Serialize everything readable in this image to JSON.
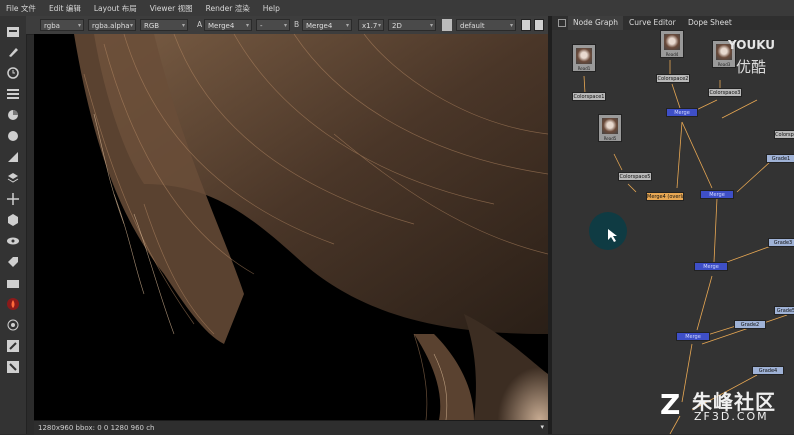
{
  "menu": [
    "File 文件",
    "Edit 编辑",
    "Layout 布局",
    "Viewer 视图",
    "Render 渲染",
    "Help"
  ],
  "viewer_toolbar": {
    "channels": "rgba",
    "channel_alpha": "rgba.alpha",
    "display": "RGB",
    "a_label": "A",
    "a_input": "Merge4",
    "dash": "-",
    "b_label": "B",
    "b_input": "Merge4",
    "zoom": "x1.7",
    "view_mode": "2D",
    "lut": "default"
  },
  "status": {
    "text": "1280x960 bbox: 0 0 1280 960 ch",
    "caret": "▾"
  },
  "node_graph": {
    "tabs": [
      "Node Graph",
      "Curve Editor",
      "Dope Sheet"
    ],
    "thumbs": [
      "Read1",
      "Read4",
      "Read3",
      "Read5"
    ],
    "nodes": [
      "Colorspace1",
      "Colorspace2",
      "Colorspace3",
      "Colorspace4",
      "Colorspace5",
      "Merge4 (overlay)",
      "Merge",
      "Merge",
      "Merge",
      "Merge",
      "Grade1",
      "Grade2",
      "Grade3",
      "Grade4",
      "Grade5"
    ]
  },
  "watermarks": {
    "youku_en": "YOUKU",
    "youku_cn": "优酷",
    "zf_cn": "朱峰社区",
    "zf_url": "ZF3D.COM",
    "zf_logo": "Z"
  },
  "colors": {
    "accent": "#e7a753",
    "node_blue": "#3e4fc7",
    "node_grey": "#b9b9b9"
  }
}
